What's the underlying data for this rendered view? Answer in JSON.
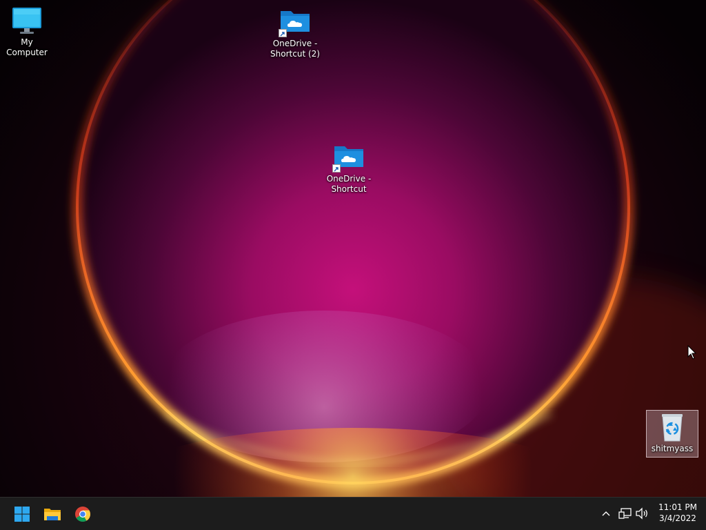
{
  "desktop": {
    "icons": {
      "my_computer": {
        "label": "My Computer",
        "icon": "monitor-icon"
      },
      "onedrive_shortcut_2": {
        "label_line1": "OneDrive -",
        "label_line2": "Shortcut (2)",
        "icon": "onedrive-folder-icon"
      },
      "onedrive_shortcut": {
        "label_line1": "OneDrive -",
        "label_line2": "Shortcut",
        "icon": "onedrive-folder-icon"
      },
      "recycle_bin": {
        "label": "shitmyass",
        "icon": "recycle-bin-icon",
        "selected": true
      }
    }
  },
  "taskbar": {
    "pinned": [
      {
        "name": "Start",
        "icon": "windows-logo-icon"
      },
      {
        "name": "File Explorer",
        "icon": "folder-icon"
      },
      {
        "name": "Google Chrome",
        "icon": "chrome-icon"
      }
    ],
    "tray": {
      "icons": [
        "chevron-up-icon",
        "network-icon",
        "volume-icon"
      ]
    },
    "clock": {
      "time": "11:01 PM",
      "date": "3/4/2022"
    }
  },
  "colors": {
    "taskbar_bg": "#1c1c1c",
    "folder_blue": "#1e8fe0",
    "windows_blue": "#2ea8f0",
    "selection": "#b496a0"
  }
}
